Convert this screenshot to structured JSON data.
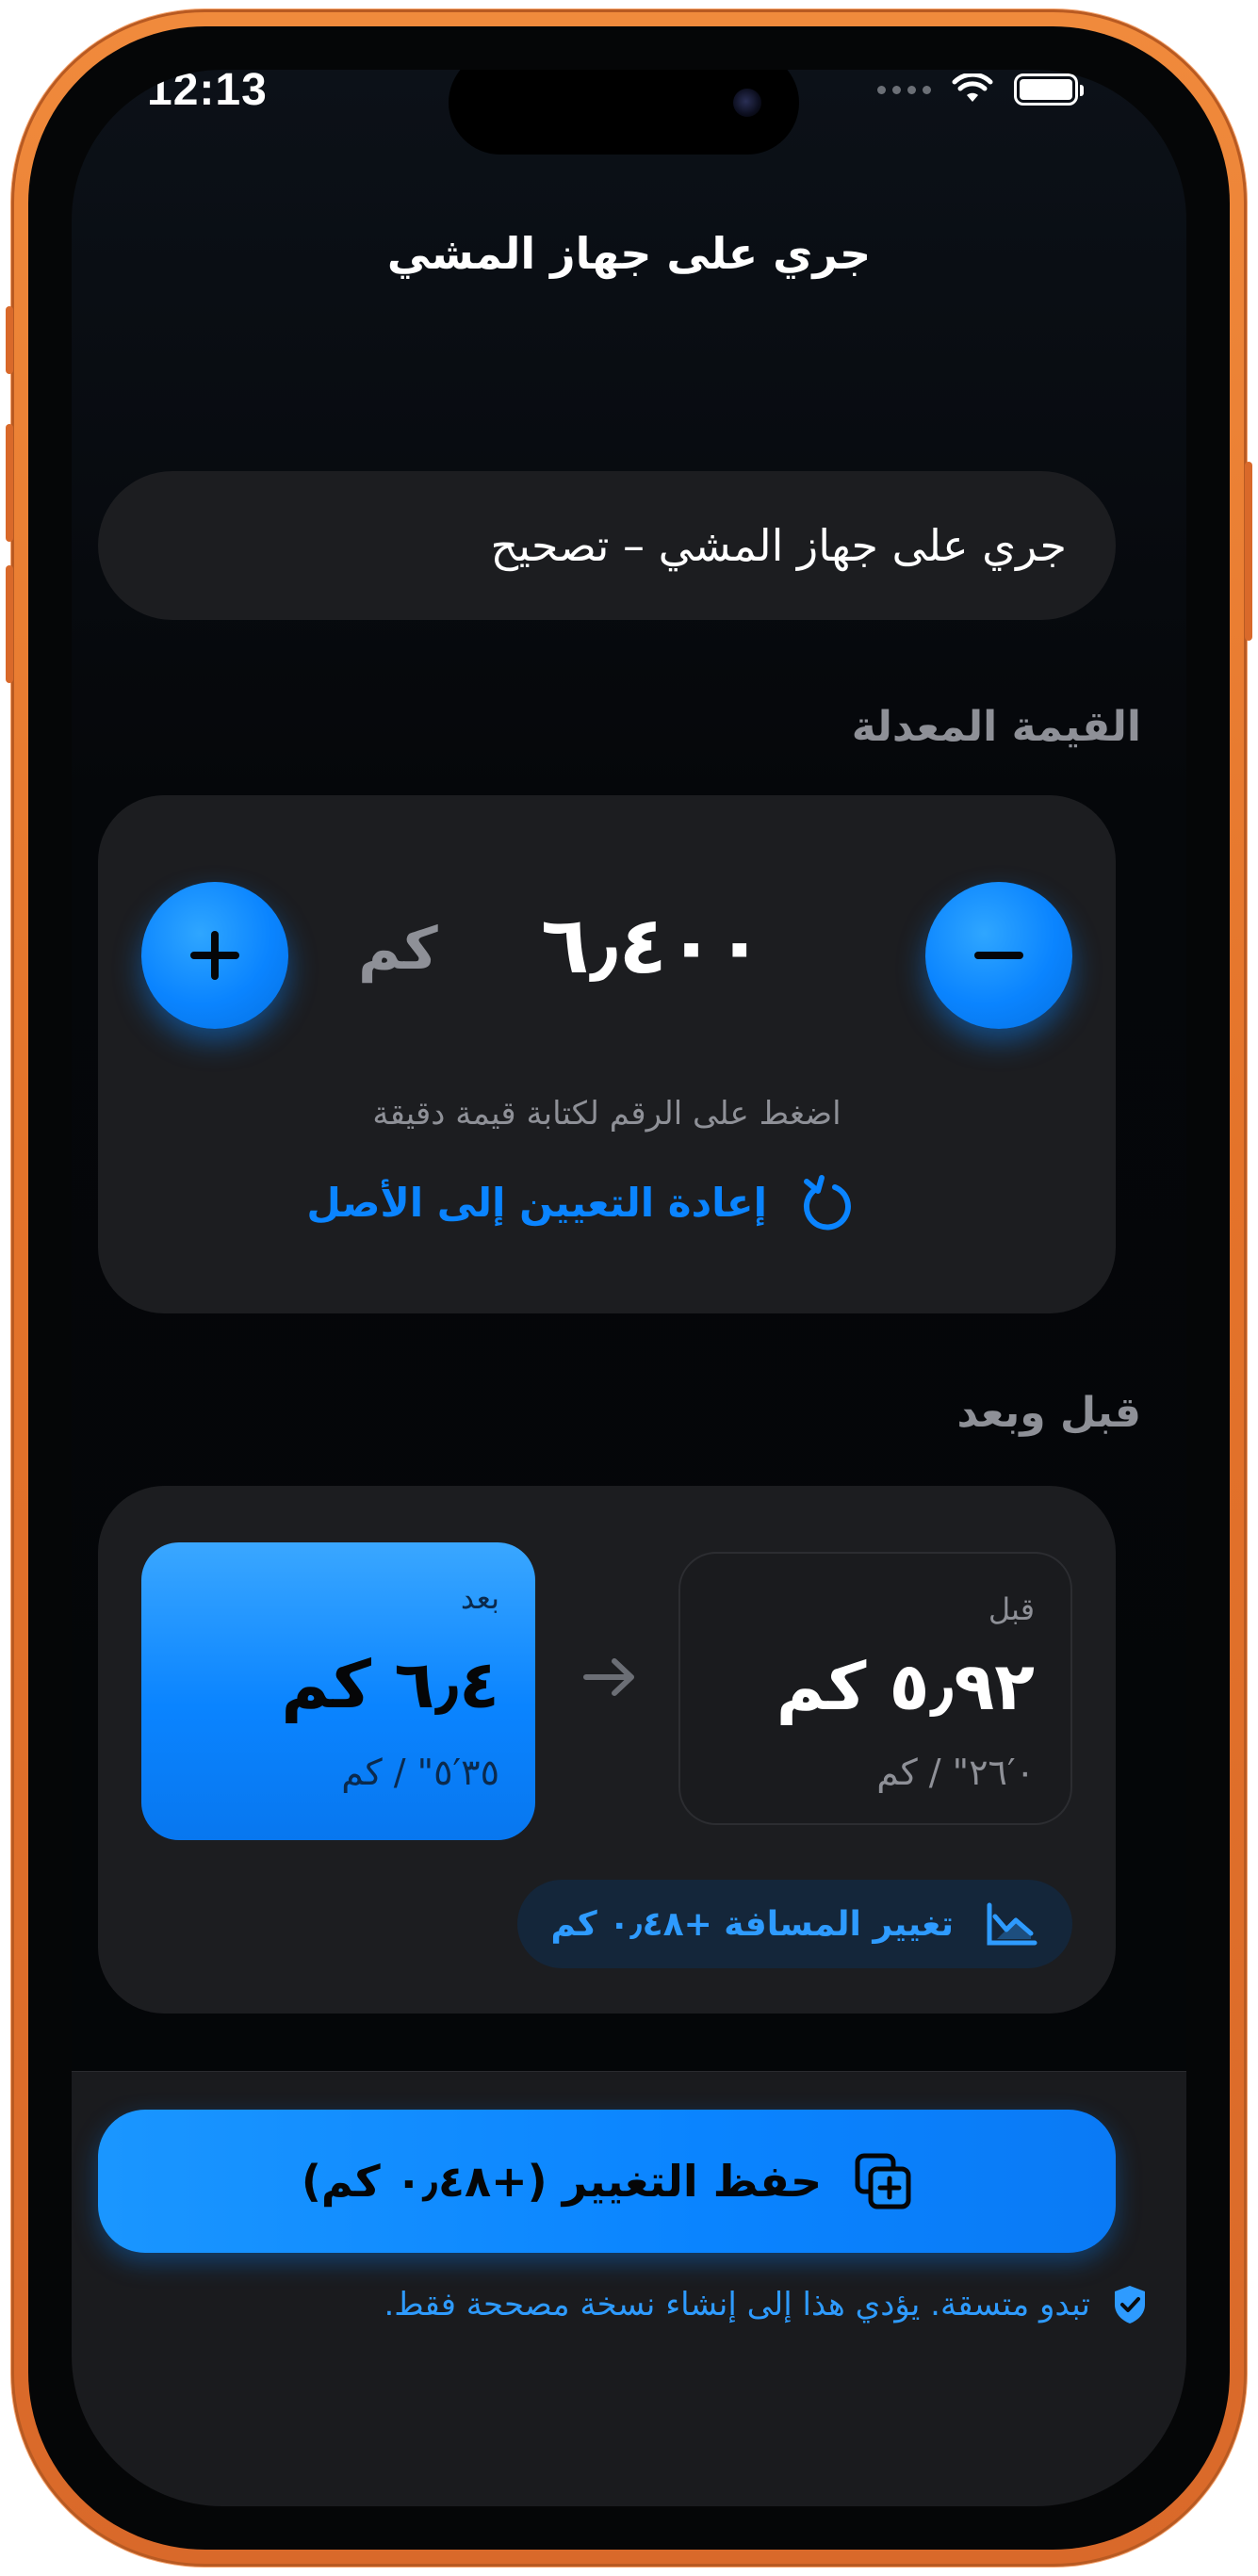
{
  "status_bar": {
    "time": "12:13"
  },
  "nav": {
    "title": "جري على جهاز المشي"
  },
  "entry": {
    "name": "جري على جهاز المشي – تصحيح"
  },
  "adjusted": {
    "section_label": "القيمة المعدلة",
    "value": "٦٫٤٠٠",
    "unit": "كم",
    "hint": "اضغط على الرقم لكتابة قيمة دقيقة",
    "reset_label": "إعادة التعيين إلى الأصل"
  },
  "comparison": {
    "section_label": "قبل وبعد",
    "before": {
      "label": "قبل",
      "value": "٥٫٩٢ كم",
      "pace": "٠′٢٦\" / كم"
    },
    "after": {
      "label": "بعد",
      "value": "٦٫٤ كم",
      "pace": "٣٥′٥\" / كم"
    },
    "delta_label": "تغيير المسافة +٠٫٤٨ كم"
  },
  "save": {
    "label": "حفظ التغيير (+٠٫٤٨ كم)"
  },
  "footnote": {
    "text": "تبدو متسقة. يؤدي هذا إلى إنشاء نسخة مصححة فقط."
  },
  "colors": {
    "accent": "#0a84ff",
    "frame": "#e4732a",
    "card": "#1c1d20",
    "background": "#05070a"
  },
  "icons": {
    "plus": "plus-icon",
    "minus": "minus-icon",
    "reset": "reset-arrow-icon",
    "arrow": "arrow-right-icon",
    "chart": "chart-trend-icon",
    "save": "copy-plus-icon",
    "shield": "shield-check-icon"
  }
}
